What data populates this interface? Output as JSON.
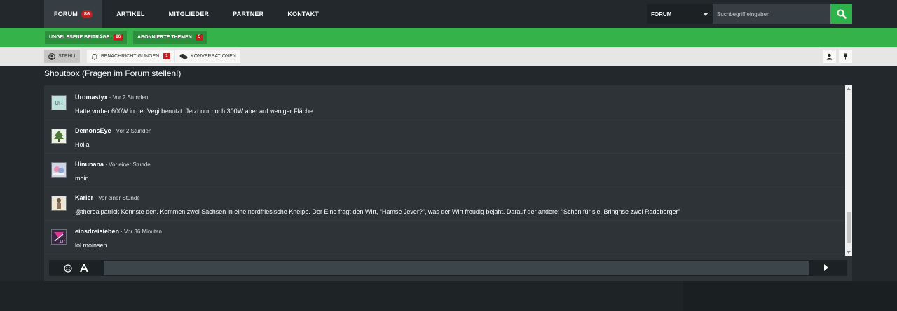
{
  "nav": {
    "items": [
      {
        "label": "Forum",
        "badge": "86",
        "active": true
      },
      {
        "label": "Artikel"
      },
      {
        "label": "Mitglieder"
      },
      {
        "label": "Partner"
      },
      {
        "label": "Kontakt"
      }
    ]
  },
  "search": {
    "scope": "Forum",
    "placeholder": "Suchbegriff eingeben",
    "button_icon": "search-icon"
  },
  "subnav": {
    "unread_label": "Ungelesene Beiträge",
    "unread_count": "86",
    "subscribed_label": "Abonnierte Themen",
    "subscribed_count": "5"
  },
  "userbar": {
    "user_label": "Stehli",
    "notifications_label": "Benachrichtigungen",
    "notifications_count": "1",
    "conversations_label": "Konversationen"
  },
  "shoutbox": {
    "title": "Shoutbox (Fragen im Forum stellen!)",
    "messages": [
      {
        "user": "Uromastyx",
        "time": "Vor 2 Stunden",
        "text": "Hatte vorher 600W in der Vegi benutzt. Jetzt nur noch 300W aber auf weniger Fläche.",
        "avatar_initials": "UR"
      },
      {
        "user": "DemonsEye",
        "time": "Vor 2 Stunden",
        "text": "Holla"
      },
      {
        "user": "Hinunana",
        "time": "Vor einer Stunde",
        "text": "moin"
      },
      {
        "user": "Karler",
        "time": "Vor einer Stunde",
        "text": "@therealpatrick Kennste den. Kommen zwei Sachsen in eine nordfriesische Kneipe. Der Eine fragt den Wirt, “Hamse Jever?”, was der Wirt freudig bejaht. Darauf der andere: “Schön für sie. Bringnse zwei Radeberger”"
      },
      {
        "user": "einsdreisieben",
        "time": "Vor 36 Minuten",
        "text": "lol moinsen",
        "avatar_text": "137"
      }
    ],
    "separator": " · "
  },
  "colors": {
    "accent_green": "#36b24a",
    "badge_red": "#c0201f",
    "background": "#22282b",
    "panel": "#2d3337"
  }
}
